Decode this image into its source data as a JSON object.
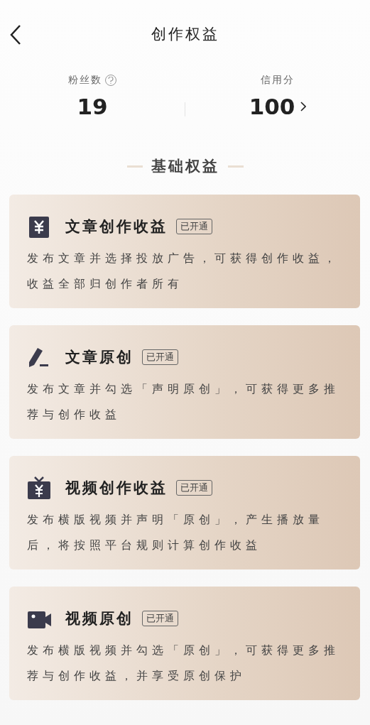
{
  "header": {
    "title": "创作权益"
  },
  "stats": [
    {
      "label": "粉丝数",
      "value": "19",
      "kind": "help"
    },
    {
      "label": "信用分",
      "value": "100",
      "kind": "link"
    }
  ],
  "section": {
    "title": "基础权益"
  },
  "cards": [
    {
      "kind": "yen",
      "title": "文章创作收益",
      "badge": "已开通",
      "description": "发布文章并选择投放广告，可获得创作收益，收益全部归创作者所有"
    },
    {
      "kind": "pen",
      "title": "文章原创",
      "badge": "已开通",
      "description": "发布文章并勾选「声明原创」，可获得更多推荐与创作收益"
    },
    {
      "kind": "tv",
      "title": "视频创作收益",
      "badge": "已开通",
      "description": "发布横版视频并声明「原创」，产生播放量后，将按照平台规则计算创作收益"
    },
    {
      "kind": "camera",
      "title": "视频原创",
      "badge": "已开通",
      "description": "发布横版视频并勾选「原创」，可获得更多推荐与创作收益，并享受原创保护"
    }
  ]
}
